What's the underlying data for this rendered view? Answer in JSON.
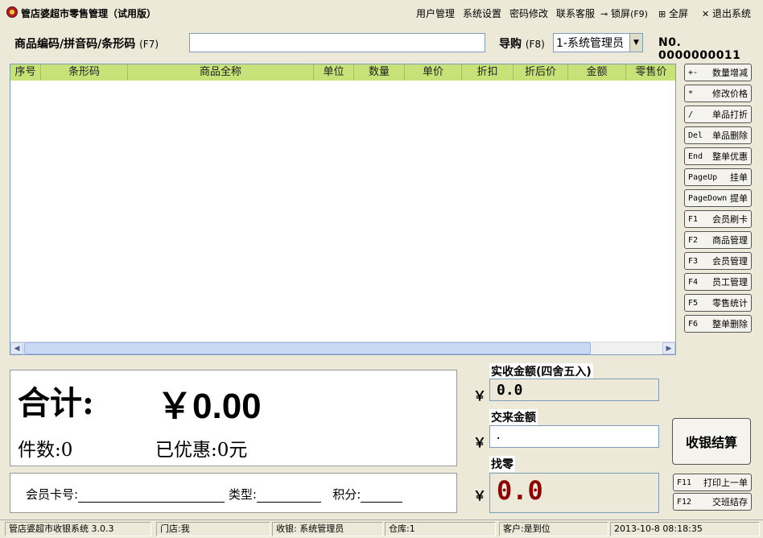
{
  "window": {
    "title": "管店婆超市零售管理（试用版）"
  },
  "menu": {
    "user_mgmt": "用户管理",
    "settings": "系统设置",
    "password": "密码修改",
    "support": "联系客服",
    "lock": "锁屏",
    "lock_key": "(F9)",
    "fullscreen": "全屏",
    "exit": "退出系统"
  },
  "search": {
    "label": "商品编码/拼音码/条形码",
    "hotkey": "(F7)",
    "value": ""
  },
  "guide": {
    "label": "导购",
    "hotkey": "(F8)",
    "selected": "1-系统管理员"
  },
  "order": {
    "number": "N0. 0000000011"
  },
  "grid": {
    "columns": [
      "序号",
      "条形码",
      "商品全称",
      "单位",
      "数量",
      "单价",
      "折扣",
      "折后价",
      "金额",
      "零售价"
    ]
  },
  "side_buttons": [
    {
      "key": "+-",
      "label": "数量增减"
    },
    {
      "key": "*",
      "label": "修改价格"
    },
    {
      "key": "/",
      "label": "单品打折"
    },
    {
      "key": "Del",
      "label": "单品删除"
    },
    {
      "key": "End",
      "label": "整单优惠"
    },
    {
      "key": "PageUp",
      "label": "挂单"
    },
    {
      "key": "PageDown",
      "label": "提单"
    },
    {
      "key": "F1",
      "label": "会员刷卡"
    },
    {
      "key": "F2",
      "label": "商品管理"
    },
    {
      "key": "F3",
      "label": "会员管理"
    },
    {
      "key": "F4",
      "label": "员工管理"
    },
    {
      "key": "F5",
      "label": "零售统计"
    },
    {
      "key": "F6",
      "label": "整单删除"
    }
  ],
  "totals": {
    "label": "合计:",
    "value": "￥0.00",
    "count": "件数:0",
    "discount": "已优惠:0元"
  },
  "member": {
    "card": "会员卡号:",
    "type": "类型:",
    "points": "积分:"
  },
  "payment": {
    "actual_label": "实收金额(四舍五入)",
    "actual_value": "0.0",
    "paid_label": "交来金额",
    "paid_value": ".",
    "change_label": "找零",
    "change_value": "0.0",
    "yen": "￥",
    "settle": "收银结算",
    "print_key": "F11",
    "print_label": "打印上一单",
    "close_key": "F12",
    "close_label": "交班结存"
  },
  "status": {
    "system": "管店婆超市收银系统 3.0.3",
    "store": "门店:我",
    "cashier": "收银: 系统管理员",
    "warehouse": "仓库:1",
    "customer": "客户:是到位",
    "datetime": "2013-10-8 08:18:35"
  }
}
